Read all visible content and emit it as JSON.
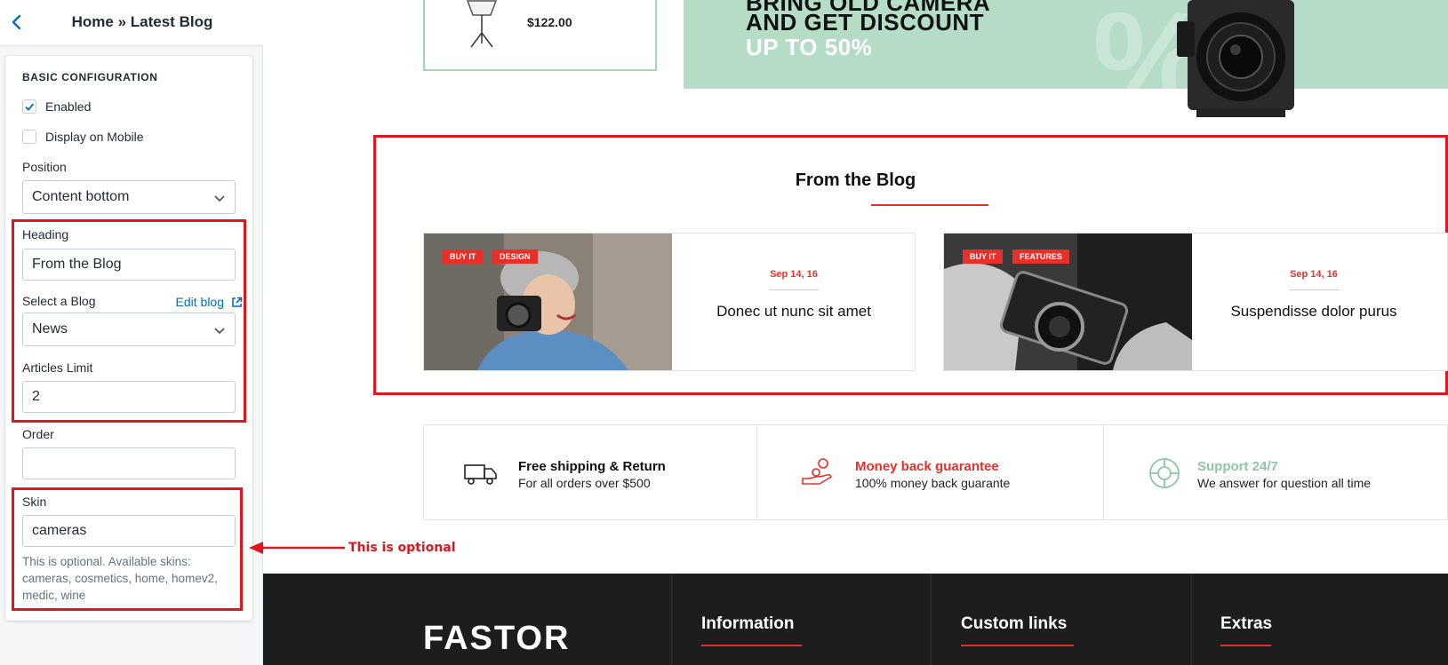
{
  "sidebar": {
    "breadcrumb": "Home » Latest Blog",
    "section_title": "BASIC CONFIGURATION",
    "enabled": {
      "label": "Enabled",
      "checked": true
    },
    "display_mobile": {
      "label": "Display on Mobile",
      "checked": false
    },
    "position": {
      "label": "Position",
      "value": "Content bottom"
    },
    "heading": {
      "label": "Heading",
      "value": "From the Blog"
    },
    "select_blog": {
      "label": "Select a Blog",
      "value": "News",
      "edit_link": "Edit blog"
    },
    "articles_limit": {
      "label": "Articles Limit",
      "value": "2"
    },
    "order": {
      "label": "Order",
      "value": ""
    },
    "skin": {
      "label": "Skin",
      "value": "cameras",
      "help": "This is optional. Available skins: cameras, cosmetics, home, homev2, medic, wine"
    }
  },
  "annotation": {
    "text": "This is optional"
  },
  "preview": {
    "product_price": "$122.00",
    "promo": {
      "line1": "BRING OLD CAMERA",
      "line2": "AND GET DISCOUNT",
      "line3": "UP TO 50%",
      "pct": "%"
    },
    "blog_heading": "From the Blog",
    "posts": [
      {
        "tags": [
          "BUY IT",
          "DESIGN"
        ],
        "date": "Sep 14, 16",
        "title": "Donec ut nunc sit amet"
      },
      {
        "tags": [
          "BUY IT",
          "FEATURES"
        ],
        "date": "Sep 14, 16",
        "title": "Suspendisse dolor purus"
      }
    ],
    "features": [
      {
        "title": "Free shipping & Return",
        "subtitle": "For all orders over $500",
        "color": "#111111",
        "icon": "truck-icon"
      },
      {
        "title": "Money back guarantee",
        "subtitle": "100% money back guarante",
        "color": "#e8302a",
        "icon": "money-hand-icon"
      },
      {
        "title": "Support 24/7",
        "subtitle": "We answer for question all time",
        "color": "#8cc7a3",
        "icon": "lifebuoy-icon"
      }
    ],
    "footer": {
      "logo": "FASTOR",
      "headings": [
        "Information",
        "Custom links",
        "Extras"
      ]
    }
  },
  "colors": {
    "accent_red": "#e8302a",
    "annotation_red": "#e0161f",
    "link_blue": "#006fbb",
    "promo_green": "#b4dcc6"
  }
}
